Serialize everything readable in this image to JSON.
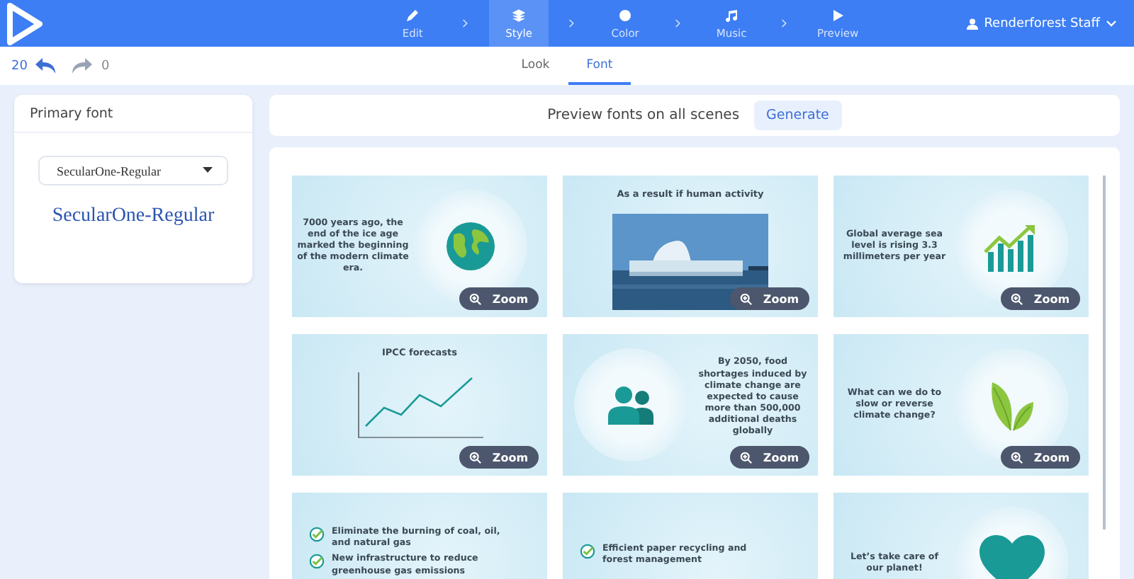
{
  "header": {
    "steps": [
      {
        "label": "Edit",
        "selected": false
      },
      {
        "label": "Style",
        "selected": true
      },
      {
        "label": "Color",
        "selected": false
      },
      {
        "label": "Music",
        "selected": false
      },
      {
        "label": "Preview",
        "selected": false
      }
    ],
    "user": "Renderforest Staff"
  },
  "toolbar": {
    "undo_count": "20",
    "redo_count": "0",
    "redo_disabled": true,
    "tabs": [
      {
        "label": "Look",
        "selected": false
      },
      {
        "label": "Font",
        "selected": true
      }
    ]
  },
  "font_panel": {
    "title": "Primary font",
    "select_value": "SecularOne-Regular",
    "preview": "SecularOne-Regular"
  },
  "preview_bar": {
    "text": "Preview fonts on all scenes",
    "button": "Generate"
  },
  "scenes": [
    {
      "kind": "globe",
      "text": "7000 years ago, the end of the ice age marked the beginning of the modern climate era.",
      "zoom": "Zoom"
    },
    {
      "text": "As a result if human activity",
      "zoom": "Zoom"
    },
    {
      "kind": "growth",
      "text": "Global average sea level is rising 3.3 millimeters per year",
      "zoom": "Zoom"
    },
    {
      "kind": "chart",
      "text": "IPCC forecasts",
      "zoom": "Zoom"
    },
    {
      "kind": "people",
      "text": "By 2050, food shortages induced by climate change are expected to cause more than 500,000 additional deaths globally",
      "zoom": "Zoom"
    },
    {
      "kind": "leaf",
      "text": "What can we do to slow or reverse climate change?",
      "zoom": "Zoom"
    },
    {
      "kind": "checklist",
      "items": [
        "Eliminate the burning of coal, oil, and natural gas",
        "New infrastructure to reduce greenhouse gas emissions"
      ]
    },
    {
      "kind": "checklist",
      "items": [
        "Efficient paper recycling and forest management"
      ]
    },
    {
      "kind": "heart",
      "text": "Let’s take care of our planet!"
    }
  ]
}
